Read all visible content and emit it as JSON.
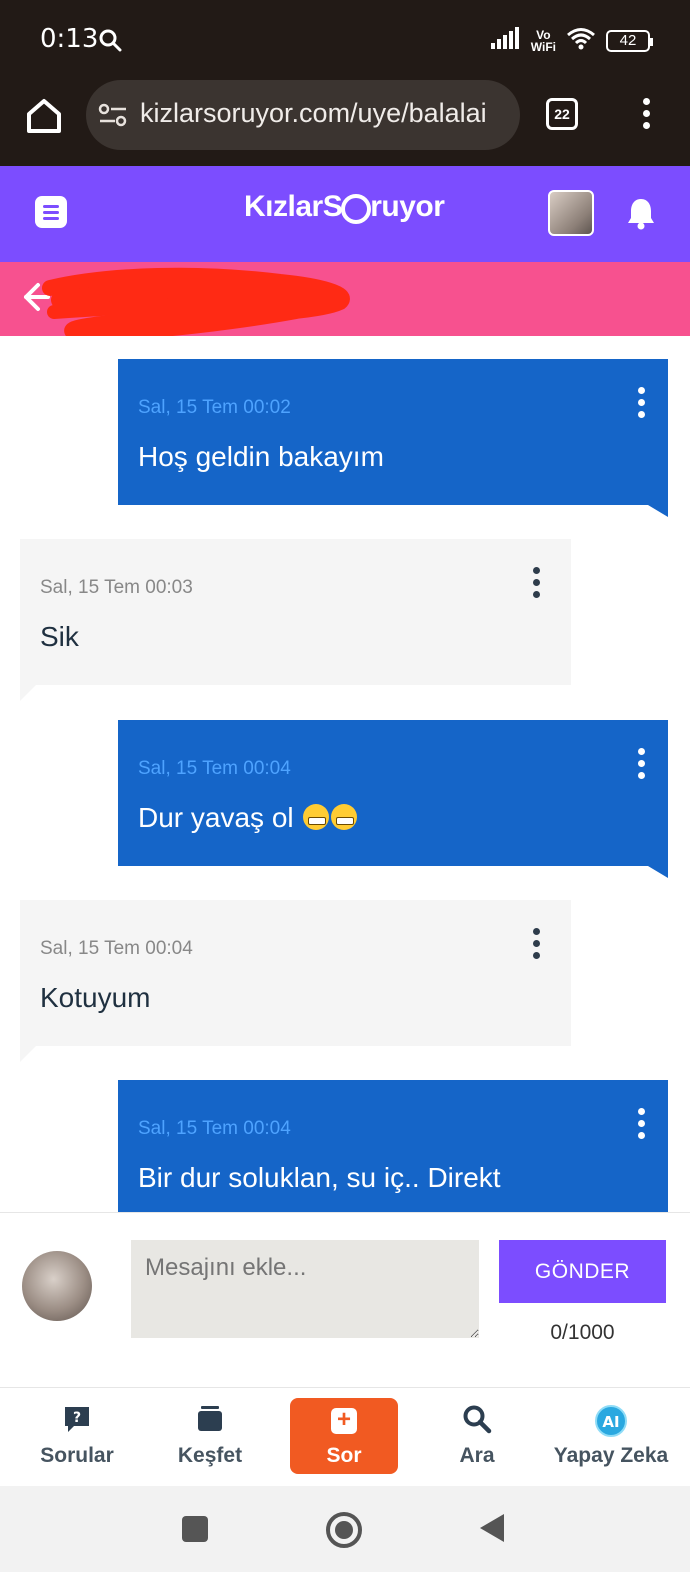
{
  "status_bar": {
    "time": "0:13",
    "network_label_top": "Vo",
    "network_label_bottom": "WiFi",
    "battery": "42"
  },
  "browser": {
    "url": "kizlarsoruyor.com/uye/balalai",
    "tab_count": "22"
  },
  "header": {
    "logo_part1": "Kızlar",
    "logo_part2": "S",
    "logo_part3": "ruyor"
  },
  "messages": [
    {
      "side": "sent",
      "time": "Sal, 15 Tem 00:02",
      "text": "Hoş geldin bakayım"
    },
    {
      "side": "recv",
      "time": "Sal, 15 Tem 00:03",
      "text": "Sik"
    },
    {
      "side": "sent",
      "time": "Sal, 15 Tem 00:04",
      "text": "Dur yavaş ol"
    },
    {
      "side": "recv",
      "time": "Sal, 15 Tem 00:04",
      "text": "Kotuyum"
    },
    {
      "side": "sent",
      "time": "Sal, 15 Tem 00:04",
      "text": "Bir dur soluklan, su iç.. Direkt"
    }
  ],
  "compose": {
    "placeholder": "Mesajını ekle...",
    "send_label": "GÖNDER",
    "char_count": "0/1000"
  },
  "bottom_nav": {
    "sorular": "Sorular",
    "kesfet": "Keşfet",
    "sor": "Sor",
    "ara": "Ara",
    "yapay_zeka": "Yapay Zeka"
  },
  "colors": {
    "header_purple": "#7c4dff",
    "banner_pink": "#f7518f",
    "sent_bubble": "#1565c8",
    "recv_bubble": "#f5f5f5",
    "sor_orange": "#f15a22"
  }
}
